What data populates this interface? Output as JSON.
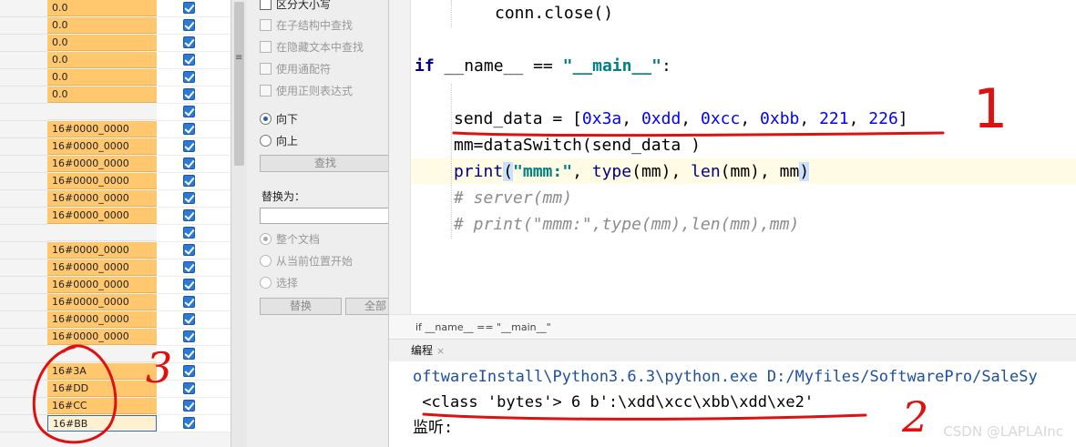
{
  "table": {
    "rows": [
      {
        "value": "0.0",
        "checked": true
      },
      {
        "value": "0.0",
        "checked": true
      },
      {
        "value": "0.0",
        "checked": true
      },
      {
        "value": "0.0",
        "checked": true
      },
      {
        "value": "0.0",
        "checked": true
      },
      {
        "value": "0.0",
        "checked": true
      },
      {
        "value": "",
        "checked": true
      },
      {
        "value": "16#0000_0000",
        "checked": true
      },
      {
        "value": "16#0000_0000",
        "checked": true
      },
      {
        "value": "16#0000_0000",
        "checked": true
      },
      {
        "value": "16#0000_0000",
        "checked": true
      },
      {
        "value": "16#0000_0000",
        "checked": true
      },
      {
        "value": "16#0000_0000",
        "checked": true
      },
      {
        "value": "",
        "checked": true
      },
      {
        "value": "16#0000_0000",
        "checked": true
      },
      {
        "value": "16#0000_0000",
        "checked": true
      },
      {
        "value": "16#0000_0000",
        "checked": true
      },
      {
        "value": "16#0000_0000",
        "checked": true
      },
      {
        "value": "16#0000_0000",
        "checked": true
      },
      {
        "value": "16#0000_0000",
        "checked": true
      },
      {
        "value": "",
        "checked": true
      },
      {
        "value": "16#3A",
        "checked": true
      },
      {
        "value": "16#DD",
        "checked": true
      },
      {
        "value": "16#CC",
        "checked": true
      },
      {
        "value": "16#BB",
        "checked": true,
        "selected": true
      }
    ]
  },
  "find_panel": {
    "options": [
      "区分大小写",
      "在子结构中查找",
      "在隐藏文本中查找",
      "使用通配符",
      "使用正则表达式"
    ],
    "direction_down": "向下",
    "direction_up": "向上",
    "find_button": "查找",
    "replace_label": "替换为：",
    "scope_options": [
      "整个文档",
      "从当前位置开始",
      "选择"
    ],
    "replace_button": "替换",
    "replace_all_button": "全部"
  },
  "editor": {
    "line_close": "conn.close()",
    "if_kw": "if",
    "if_name": "__name__",
    "if_eq": "==",
    "if_str": "\"__main__\"",
    "if_colon": ":",
    "send_var": "send_data = [",
    "send_values": [
      "0x3a",
      "0xdd",
      "0xcc",
      "0xbb",
      "221",
      "226"
    ],
    "send_end": "]",
    "mm_line": "mm=dataSwitch(send_data )",
    "print_fn": "print",
    "print_open": "(",
    "print_str": "\"mmm:\"",
    "print_mid1": ", ",
    "print_type": "type",
    "print_mid2": "(mm), ",
    "print_len": "len",
    "print_mid3": "(mm), mm",
    "print_close": ")",
    "comment1": "# server(mm)",
    "comment2": "# print(\"mmm:\",type(mm),len(mm),mm)"
  },
  "breadcrumb": "if __name__ == \"__main__\"",
  "run_panel": {
    "tab_label": "编程",
    "tab_close": "×",
    "console_path": "oftwareInstall\\Python3.6.3\\python.exe D:/Myfiles/SoftwarePro/SaleSy",
    "console_output": " <class 'bytes'> 6 b':\\xdd\\xcc\\xbb\\xdd\\xe2'",
    "console_listen": "监听:"
  },
  "watermark": "CSDN @LAPLAInc",
  "annotations": {
    "mark_3": "3",
    "mark_1": "1",
    "mark_2": "2"
  },
  "colors": {
    "value_cell": "#ffc76e",
    "checkbox": "#2b7ad9",
    "annotation": "#e01010",
    "keyword": "#000080",
    "string": "#008080",
    "number": "#0000ff"
  }
}
